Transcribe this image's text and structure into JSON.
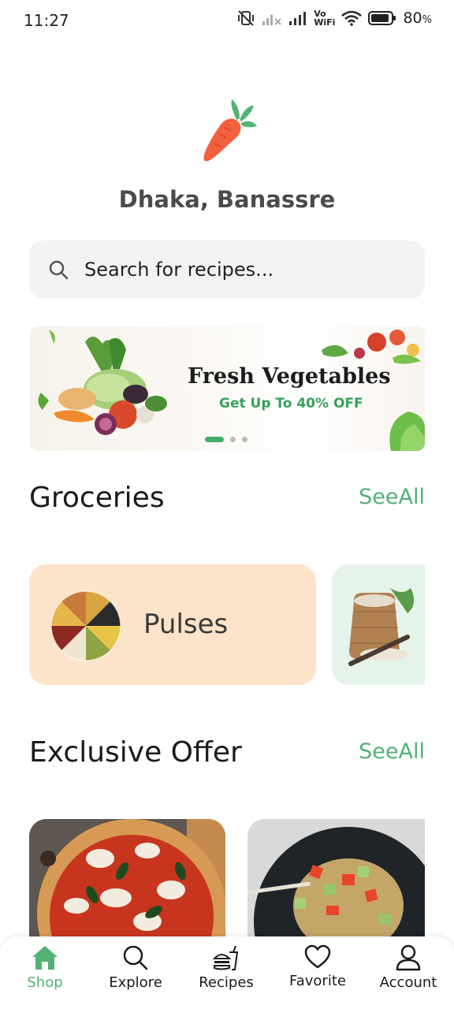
{
  "status_bar": {
    "time": "11:27",
    "battery": "80",
    "battery_unit": "%",
    "network_label_top": "Vo",
    "network_label_bottom": "WiFi"
  },
  "location": "Dhaka, Banassre",
  "search": {
    "placeholder": "Search for recipes..."
  },
  "banner": {
    "title": "Fresh Vegetables",
    "subtitle": "Get Up To 40% OFF",
    "slide_count": 3,
    "active_slide": 1
  },
  "groceries": {
    "title": "Groceries",
    "see_all": "SeeAll",
    "items": [
      {
        "label": "Pulses",
        "color": "#FDE3C9"
      },
      {
        "label": "",
        "color": "#E5F3EA"
      }
    ]
  },
  "exclusive_offer": {
    "title": "Exclusive Offer",
    "see_all": "SeeAll"
  },
  "bottom_nav": {
    "items": [
      {
        "label": "Shop",
        "icon": "home-icon",
        "active": true
      },
      {
        "label": "Explore",
        "icon": "search-icon",
        "active": false
      },
      {
        "label": "Recipes",
        "icon": "burger-drink-icon",
        "active": false
      },
      {
        "label": "Favorite",
        "icon": "heart-icon",
        "active": false
      },
      {
        "label": "Account",
        "icon": "user-icon",
        "active": false
      }
    ]
  },
  "colors": {
    "accent": "#53B175",
    "carrot": "#F3603F",
    "leaf": "#53B175"
  }
}
